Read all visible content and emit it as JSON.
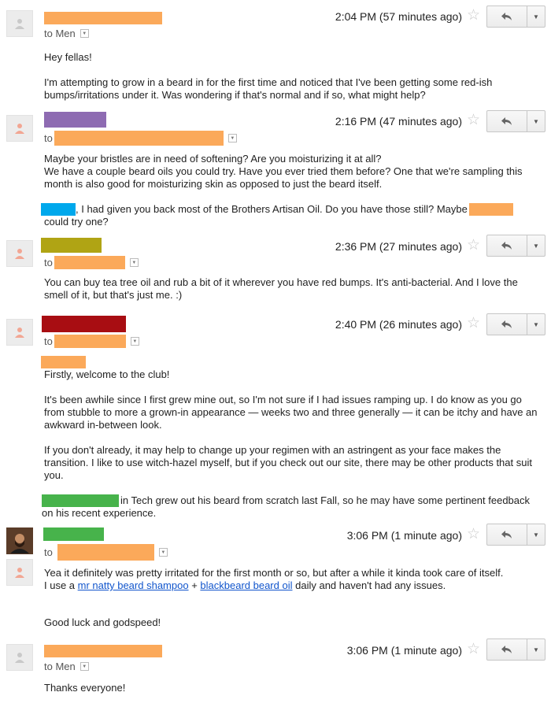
{
  "colors": {
    "redact_orange": "#fba95a",
    "purple": "#8e6bb2",
    "olive": "#b0a414",
    "crimson": "#a80d12",
    "green": "#47b34b",
    "cyan": "#00a8ec",
    "link": "#1155cc"
  },
  "icons": {
    "avatar": "person-icon",
    "star": "star-icon",
    "reply": "reply-icon",
    "more": "chevron-down-icon"
  },
  "messages": [
    {
      "time": "2:04 PM (57 minutes ago)",
      "to_label": "to Men",
      "lines": [
        "Hey fellas!",
        "I'm attempting to grow in a beard in for the first time and noticed that I've been getting some red-ish bumps/irritations under it. Was wondering if that's normal and if so, what might help?"
      ]
    },
    {
      "time": "2:16 PM (47 minutes ago)",
      "to_label": "to",
      "lines": [
        "Maybe your bristles are in need of softening? Are you moisturizing it at all?",
        "We have a couple beard oils you could try. Have you ever tried them before? One that we're sampling this month is also good for moisturizing skin as opposed to just the beard itself.",
        ", I had given you back most of the Brothers Artisan Oil. Do you have those still? Maybe",
        "could try one?"
      ]
    },
    {
      "time": "2:36 PM (27 minutes ago)",
      "to_label": "to",
      "lines": [
        "You can buy tea tree oil and rub a bit of it wherever you have red bumps. It's anti-bacterial. And I love the smell of it, but that's just me. :)"
      ]
    },
    {
      "time": "2:40 PM (26 minutes ago)",
      "to_label": "to",
      "lines": [
        "Firstly, welcome to the club!",
        "It's been awhile since I first grew mine out, so I'm not sure if I had issues ramping up. I do know as you go from stubble to more a grown-in appearance — weeks two and three generally — it can be itchy and have an awkward in-between look.",
        "If you don't already, it may help to change up your regimen with an astringent as your face makes the transition. I like to use witch-hazel myself, but if you check out our site, there may be other products that suit you.",
        "in Tech grew out his beard from scratch last Fall, so he may have some pertinent feedback on his recent experience."
      ]
    },
    {
      "time": "3:06 PM (1 minute ago)",
      "to_label": "to",
      "lines": [
        "Yea it definitely was pretty irritated for the first month or so, but after a while it kinda took care of itself.",
        "I use a",
        "+",
        "daily and haven't had any issues.",
        "Good luck and godspeed!"
      ],
      "links": [
        "mr natty beard shampoo",
        "blackbeard beard oil"
      ]
    },
    {
      "time": "3:06 PM (1 minute ago)",
      "to_label": "to Men",
      "lines": [
        "Thanks everyone!"
      ]
    }
  ]
}
